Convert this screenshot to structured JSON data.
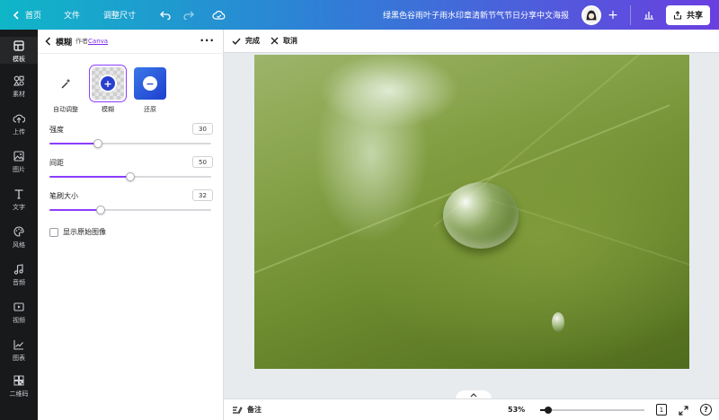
{
  "topbar": {
    "home_label": "首页",
    "file_label": "文件",
    "resize_label": "调整尺寸",
    "doc_title": "绿黑色谷雨叶子雨水印章清新节气节日分享中文海报",
    "share_label": "共享"
  },
  "rail": {
    "items": [
      {
        "label": "模板",
        "icon": "template-icon"
      },
      {
        "label": "素材",
        "icon": "elements-icon"
      },
      {
        "label": "上传",
        "icon": "upload-icon"
      },
      {
        "label": "图片",
        "icon": "photo-icon"
      },
      {
        "label": "文字",
        "icon": "text-icon"
      },
      {
        "label": "风格",
        "icon": "palette-icon"
      },
      {
        "label": "音频",
        "icon": "music-icon"
      },
      {
        "label": "视频",
        "icon": "video-icon"
      },
      {
        "label": "图表",
        "icon": "chart-icon"
      },
      {
        "label": "二维码",
        "icon": "qrcode-icon"
      }
    ]
  },
  "panel": {
    "title": "模糊",
    "author_prefix": "作者",
    "author_link": "Canva",
    "effects": [
      {
        "label": "自动调整",
        "icon": "magic-wand-icon"
      },
      {
        "label": "模糊",
        "icon": "brush-add-icon"
      },
      {
        "label": "还原",
        "icon": "minus-circle-icon"
      }
    ],
    "sliders": {
      "intensity": {
        "label": "强度",
        "value": "30",
        "fraction": 0.3
      },
      "spacing": {
        "label": "间距",
        "value": "50",
        "fraction": 0.5
      },
      "brush_size": {
        "label": "笔刷大小",
        "value": "32",
        "fraction": 0.315
      }
    },
    "show_original_label": "显示原始图像"
  },
  "editbar": {
    "done_label": "完成",
    "cancel_label": "取消"
  },
  "bottombar": {
    "notes_label": "备注",
    "zoom_label": "53%",
    "zoom_fraction": 0.08,
    "page_count": "1",
    "help_label": "?"
  },
  "colors": {
    "accent": "#8b3dff",
    "topbar_start": "#0fb6c8",
    "topbar_end": "#6a3fe0",
    "rail_bg": "#18191b"
  }
}
